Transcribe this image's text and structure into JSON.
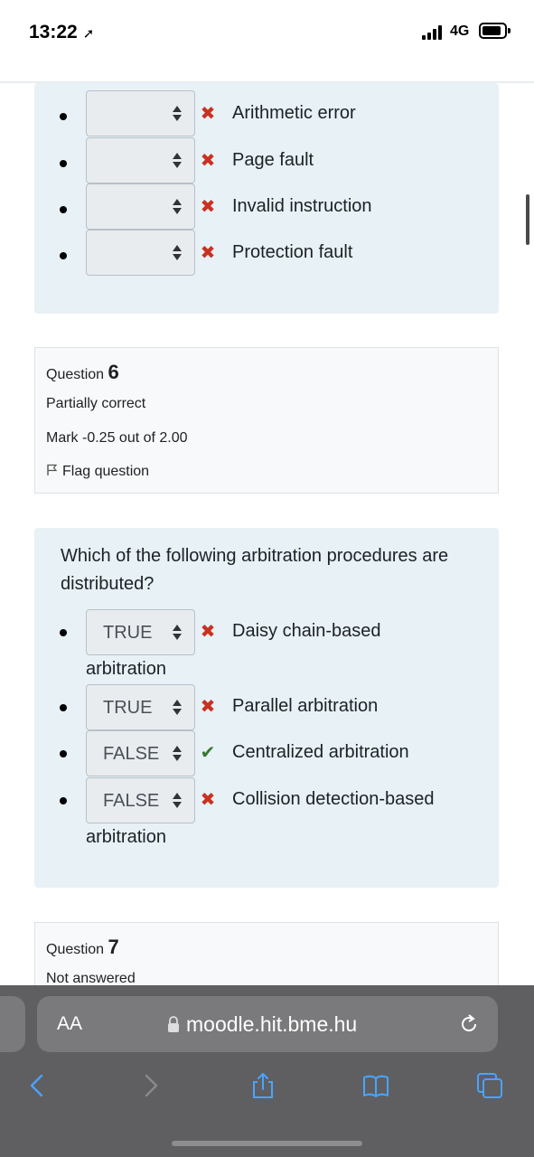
{
  "status": {
    "time": "13:22",
    "network": "4G"
  },
  "q5_partial": {
    "options": [
      {
        "selected": "",
        "mark": "incorrect",
        "text": "Arithmetic error"
      },
      {
        "selected": "",
        "mark": "incorrect",
        "text": "Page fault"
      },
      {
        "selected": "",
        "mark": "incorrect",
        "text": "Invalid instruction"
      },
      {
        "selected": "",
        "mark": "incorrect",
        "text": "Protection fault"
      }
    ]
  },
  "q6_info": {
    "label": "Question",
    "number": "6",
    "state": "Partially correct",
    "mark": "Mark -0.25 out of 2.00",
    "flag": "Flag question"
  },
  "q6": {
    "question": "Which of the following arbitration procedures are distributed?",
    "options": [
      {
        "selected": "TRUE",
        "mark": "incorrect",
        "text": "Daisy chain-based",
        "text_cont": "arbitration"
      },
      {
        "selected": "TRUE",
        "mark": "incorrect",
        "text": "Parallel arbitration"
      },
      {
        "selected": "FALSE",
        "mark": "correct",
        "text": "Centralized arbitration"
      },
      {
        "selected": "FALSE",
        "mark": "incorrect",
        "text": "Collision detection-based",
        "text_cont": "arbitration"
      }
    ]
  },
  "q7_info": {
    "label": "Question",
    "number": "7",
    "state": "Not answered"
  },
  "browser": {
    "aa": "AA",
    "url": "moodle.hit.bme.hu"
  },
  "icons": {
    "incorrect": "cross-icon",
    "correct": "check-icon",
    "flag": "flag-icon",
    "lock": "lock-icon",
    "reload": "reload-icon",
    "toolbar": [
      "back-icon",
      "forward-icon",
      "share-icon",
      "bookmarks-icon",
      "tabs-icon"
    ]
  },
  "colors": {
    "incorrect": "#ca3120",
    "correct": "#357a32",
    "panel": "#e7f1f6"
  }
}
